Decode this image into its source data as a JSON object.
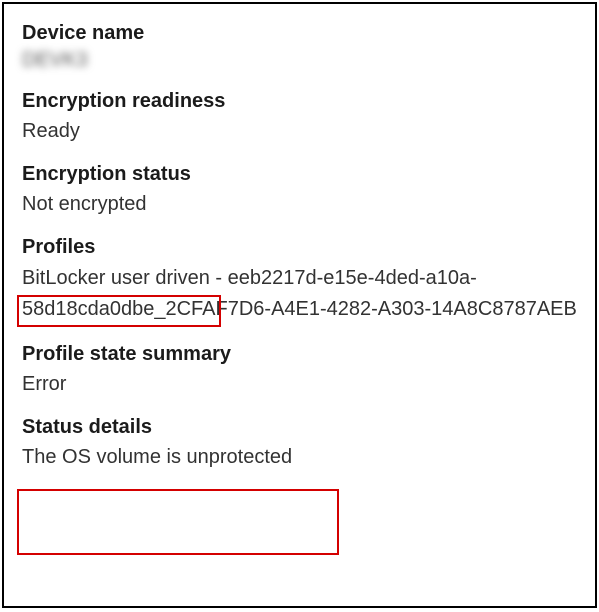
{
  "device_name": {
    "label": "Device name",
    "value": "DEVK3"
  },
  "encryption_readiness": {
    "label": "Encryption readiness",
    "value": "Ready"
  },
  "encryption_status": {
    "label": "Encryption status",
    "value": "Not encrypted"
  },
  "profiles": {
    "label": "Profiles",
    "name": "BitLocker user driven",
    "separator": " - ",
    "id": "eeb2217d-e15e-4ded-a10a-58d18cda0dbe_2CFAF7D6-A4E1-4282-A303-14A8C8787AEB"
  },
  "profile_state_summary": {
    "label": "Profile state summary",
    "value": "Error"
  },
  "status_details": {
    "label": "Status details",
    "value": "The OS volume is unprotected"
  }
}
